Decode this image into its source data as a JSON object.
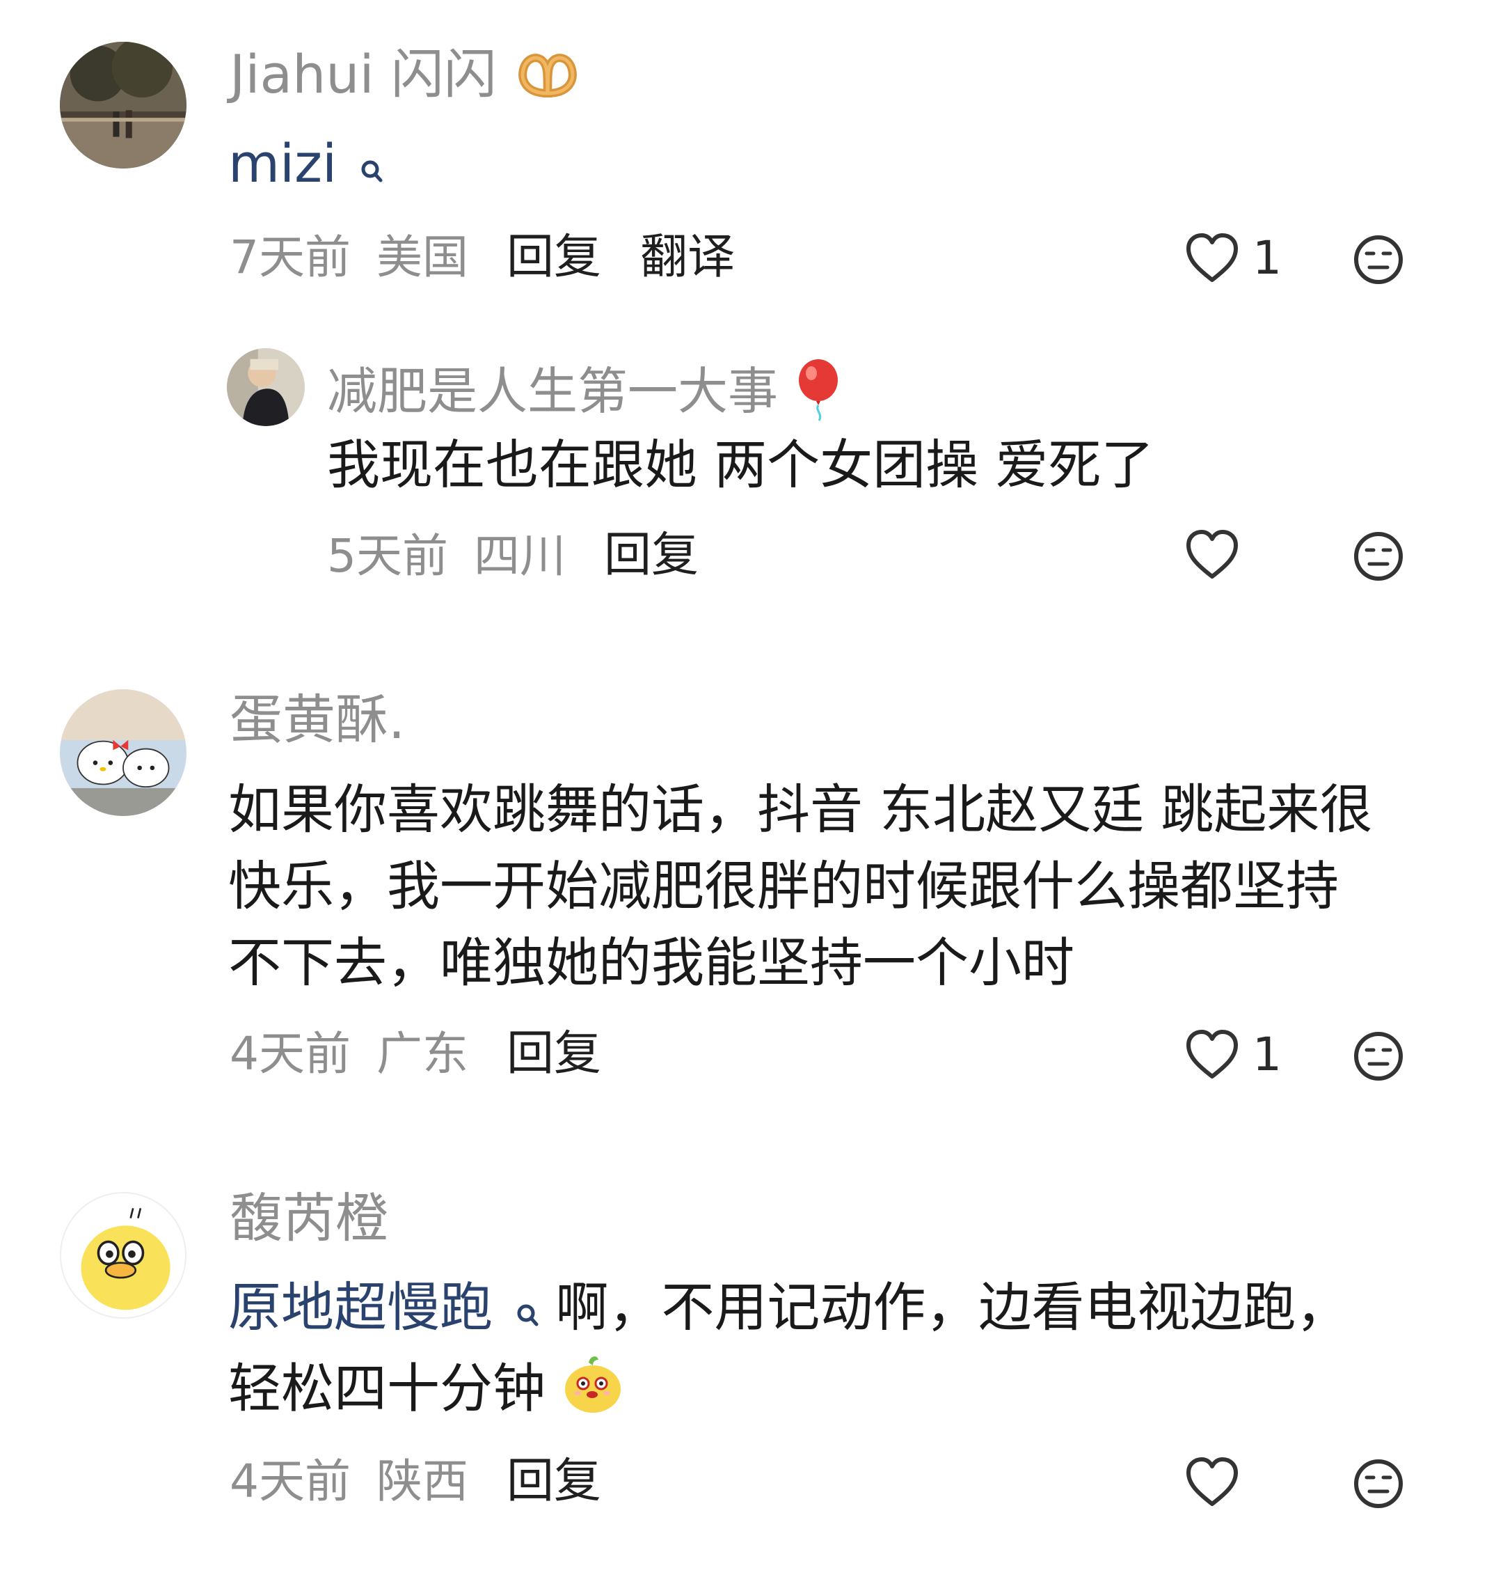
{
  "comments": [
    {
      "username": "Jiahui 闪闪",
      "username_emoji": "pretzel-emoji",
      "content_link": "mizi",
      "time": "7天前",
      "location": "美国",
      "reply_label": "回复",
      "translate_label": "翻译",
      "like_count": "1",
      "replies": [
        {
          "username": "减肥是人生第一大事",
          "username_emoji": "balloon-emoji",
          "content": "我现在也在跟她 两个女团操 爱死了",
          "time": "5天前",
          "location": "四川",
          "reply_label": "回复"
        }
      ]
    },
    {
      "username": "蛋黄酥.",
      "content_lines": [
        "如果你喜欢跳舞的话，抖音 东北赵又廷 跳起来很",
        "快乐，我一开始减肥很胖的时候跟什么操都坚持",
        "不下去，唯独她的我能坚持一个小时"
      ],
      "time": "4天前",
      "location": "广东",
      "reply_label": "回复",
      "like_count": "1"
    },
    {
      "username": "馥芮橙",
      "content_link": "原地超慢跑",
      "content_line1": "啊，不用记动作，边看电视边跑，",
      "content_line2": "轻松四十分钟",
      "content_emoji": "sticker-emoji",
      "time": "4天前",
      "location": "陕西",
      "reply_label": "回复"
    }
  ],
  "colors": {
    "username": "#8e8e8e",
    "mention": "#29426e",
    "text": "#1a1a1a"
  },
  "icons": [
    "heart-icon",
    "dislike-face-icon",
    "search-icon"
  ]
}
